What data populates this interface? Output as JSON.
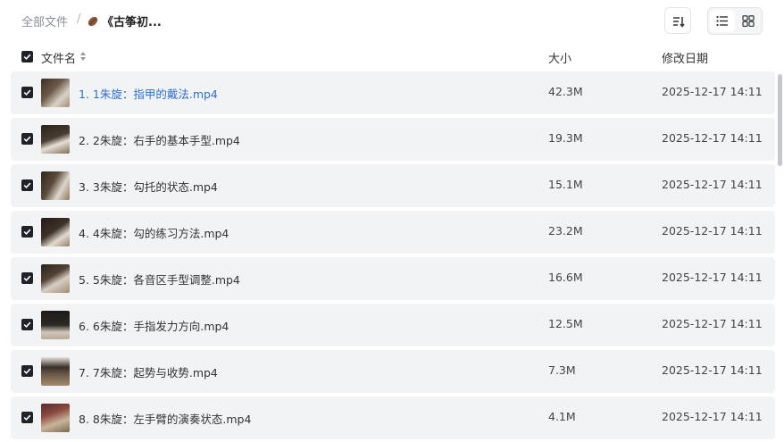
{
  "breadcrumb": {
    "root": "全部文件",
    "separator": "/",
    "current": "《古筝初..."
  },
  "toolbar": {
    "sort_icon": "sort-icon",
    "list_view_icon": "list-view-icon",
    "grid_view_icon": "grid-view-icon"
  },
  "table": {
    "headers": {
      "name": "文件名",
      "size": "大小",
      "date": "修改日期"
    },
    "rows": [
      {
        "name": "1. 1朱旋：指甲的戴法.mp4",
        "size": "42.3M",
        "date": "2025-12-17 14:11",
        "active": true
      },
      {
        "name": "2. 2朱旋：右手的基本手型.mp4",
        "size": "19.3M",
        "date": "2025-12-17 14:11",
        "active": false
      },
      {
        "name": "3. 3朱旋：勾托的状态.mp4",
        "size": "15.1M",
        "date": "2025-12-17 14:11",
        "active": false
      },
      {
        "name": "4. 4朱旋：勾的练习方法.mp4",
        "size": "23.2M",
        "date": "2025-12-17 14:11",
        "active": false
      },
      {
        "name": "5. 5朱旋：各音区手型调整.mp4",
        "size": "16.6M",
        "date": "2025-12-17 14:11",
        "active": false
      },
      {
        "name": "6. 6朱旋：手指发力方向.mp4",
        "size": "12.5M",
        "date": "2025-12-17 14:11",
        "active": false
      },
      {
        "name": "7. 7朱旋：起势与收势.mp4",
        "size": "7.3M",
        "date": "2025-12-17 14:11",
        "active": false
      },
      {
        "name": "8. 8朱旋：左手臂的演奏状态.mp4",
        "size": "4.1M",
        "date": "2025-12-17 14:11",
        "active": false
      }
    ]
  },
  "colors": {
    "accent": "#2d6fd6",
    "row_bg": "#f2f3f5",
    "checkbox": "#1f2329"
  }
}
